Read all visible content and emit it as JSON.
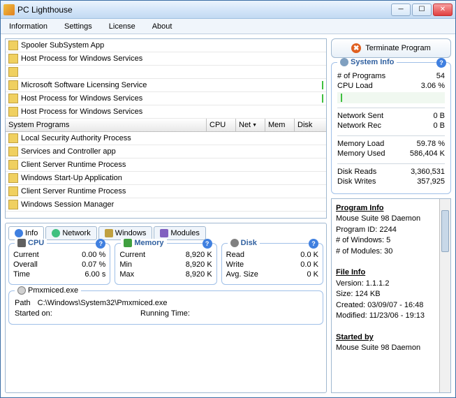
{
  "window": {
    "title": "PC Lighthouse"
  },
  "menu": {
    "information": "Information",
    "settings": "Settings",
    "license": "License",
    "about": "About"
  },
  "header": {
    "name": "System Programs",
    "cpu": "CPU",
    "net": "Net",
    "mem": "Mem",
    "disk": "Disk"
  },
  "processes_top": [
    "Spooler SubSystem App",
    "Host Process for Windows Services",
    "",
    "Microsoft Software Licensing Service",
    "Host Process for Windows Services",
    "Host Process for Windows Services"
  ],
  "processes_bottom": [
    "Local Security Authority Process",
    "Services and Controller app",
    "Client Server Runtime Process",
    "Windows Start-Up Application",
    "Client Server Runtime Process",
    "Windows Session Manager"
  ],
  "tabs": {
    "info": "Info",
    "network": "Network",
    "windows": "Windows",
    "modules": "Modules"
  },
  "groups": {
    "cpu": {
      "title": "CPU",
      "current_k": "Current",
      "current_v": "0.00 %",
      "overall_k": "Overall",
      "overall_v": "0.07 %",
      "time_k": "Time",
      "time_v": "6.00 s"
    },
    "memory": {
      "title": "Memory",
      "current_k": "Current",
      "current_v": "8,920 K",
      "min_k": "Min",
      "min_v": "8,920 K",
      "max_k": "Max",
      "max_v": "8,920 K"
    },
    "disk": {
      "title": "Disk",
      "read_k": "Read",
      "read_v": "0.0 K",
      "write_k": "Write",
      "write_v": "0.0 K",
      "avg_k": "Avg. Size",
      "avg_v": "0 K"
    }
  },
  "exec": {
    "name": "Pmxmiced.exe",
    "path_k": "Path",
    "path_v": "C:\\Windows\\System32\\Pmxmiced.exe",
    "started_k": "Started on:",
    "running_k": "Running Time:"
  },
  "terminate": "Terminate Program",
  "sysinfo": {
    "title": "System Info",
    "programs_k": "# of Programs",
    "programs_v": "54",
    "cpuload_k": "CPU Load",
    "cpuload_v": "3.06 %",
    "netsent_k": "Network Sent",
    "netsent_v": "0 B",
    "netrec_k": "Network Rec",
    "netrec_v": "0 B",
    "memload_k": "Memory Load",
    "memload_v": "59.78 %",
    "memused_k": "Memory Used",
    "memused_v": "586,404 K",
    "diskreads_k": "Disk Reads",
    "diskreads_v": "3,360,531",
    "diskwrites_k": "Disk Writes",
    "diskwrites_v": "357,925"
  },
  "proginfo": {
    "h1": "Program Info",
    "name": "Mouse Suite 98 Daemon",
    "pid": "Program ID: 2244",
    "windows": "# of Windows: 5",
    "modules": "# of Modules: 30",
    "h2": "File Info",
    "version": "Version: 1.1.1.2",
    "size": "Size: 124 KB",
    "created": "Created: 03/09/07 - 16:48",
    "modified": "Modified: 11/23/06 - 19:13",
    "h3": "Started by",
    "startby": "Mouse Suite 98 Daemon"
  }
}
